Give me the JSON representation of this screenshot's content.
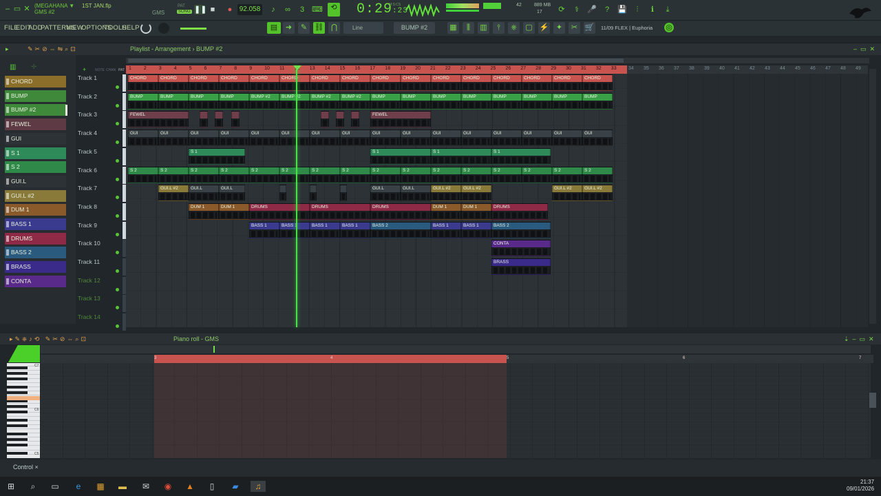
{
  "project": {
    "name": "(MEGAHANA ▼",
    "pattern": "GMS #2",
    "file": "1ST JAN.flp"
  },
  "transport": {
    "pat_label": "PAT",
    "song_label": "SONG",
    "tempo": "92.058",
    "time": "0:29",
    "time_small": ":23",
    "ms_label": "M:S:CS",
    "gms_label": "GMS"
  },
  "stats": {
    "mem": "889 MB",
    "cpu": "17",
    "poly": "42"
  },
  "menu": [
    "FILE",
    "EDIT",
    "ADD",
    "PATTERNS",
    "VIEW",
    "OPTIONS",
    "TOOLS",
    "HELP"
  ],
  "toolbar": {
    "snap": "Line",
    "pattern": "BUMP #2",
    "hint": "11/09  FLEX | Euphoria"
  },
  "playlist": {
    "title": "Playlist - Arrangement",
    "crumb": "BUMP #2",
    "snap_labels": [
      "NOTE",
      "CHAN",
      "PAT"
    ]
  },
  "browser": [
    {
      "name": "CHORD",
      "color": "#8a6e2a"
    },
    {
      "name": "BUMP",
      "color": "#3e8a3a"
    },
    {
      "name": "BUMP #2",
      "color": "#3e8a3a"
    },
    {
      "name": "FEWEL",
      "color": "#5e3a44"
    },
    {
      "name": "GUI",
      "color": "#2d3236"
    },
    {
      "name": "S 1",
      "color": "#2f8a5a"
    },
    {
      "name": "S 2",
      "color": "#2f8a4a"
    },
    {
      "name": "GUI.L",
      "color": "#2d3236"
    },
    {
      "name": "GUI.L #2",
      "color": "#8a7a3a"
    },
    {
      "name": "DUM 1",
      "color": "#8a5a2a"
    },
    {
      "name": "BASS 1",
      "color": "#3a3a8e"
    },
    {
      "name": "DRUMS",
      "color": "#8e2a46"
    },
    {
      "name": "BASS 2",
      "color": "#2a5a7e"
    },
    {
      "name": "BRASS",
      "color": "#3a2a8a"
    },
    {
      "name": "CONTA",
      "color": "#5a2a8a"
    }
  ],
  "tracks": [
    "Track 1",
    "Track 2",
    "Track 3",
    "Track 4",
    "Track 5",
    "Track 6",
    "Track 7",
    "Track 8",
    "Track 9",
    "Track 10",
    "Track 11",
    "Track 12",
    "Track 13",
    "Track 14"
  ],
  "ruler": [
    "1",
    "2",
    "3",
    "4",
    "5",
    "6",
    "7",
    "8",
    "9",
    "10",
    "11",
    "12",
    "13",
    "14",
    "15",
    "16",
    "17",
    "18",
    "19",
    "20",
    "21",
    "22",
    "23",
    "24",
    "25",
    "26",
    "27",
    "28",
    "29",
    "30",
    "31",
    "32",
    "33"
  ],
  "ruler2": [
    "34",
    "35",
    "36",
    "37",
    "38",
    "39",
    "40",
    "41",
    "42",
    "43",
    "44",
    "45",
    "46",
    "47",
    "48",
    "49"
  ],
  "clips": [
    {
      "row": 0,
      "l": 186,
      "w": 44,
      "label": "CHORD",
      "c": "#c85450"
    },
    {
      "row": 0,
      "l": 230,
      "w": 44,
      "label": "CHORD",
      "c": "#c85450"
    },
    {
      "row": 0,
      "l": 274,
      "w": 44,
      "label": "CHORD",
      "c": "#c85450"
    },
    {
      "row": 0,
      "l": 318,
      "w": 44,
      "label": "CHORD",
      "c": "#c85450"
    },
    {
      "row": 0,
      "l": 362,
      "w": 44,
      "label": "CHORD",
      "c": "#c85450"
    },
    {
      "row": 0,
      "l": 406,
      "w": 44,
      "label": "CHORD",
      "c": "#c85450"
    },
    {
      "row": 0,
      "l": 450,
      "w": 44,
      "label": "CHORD",
      "c": "#c85450"
    },
    {
      "row": 0,
      "l": 494,
      "w": 44,
      "label": "CHORD",
      "c": "#c85450"
    },
    {
      "row": 0,
      "l": 538,
      "w": 44,
      "label": "CHORD",
      "c": "#c85450"
    },
    {
      "row": 0,
      "l": 582,
      "w": 44,
      "label": "CHORD",
      "c": "#c85450"
    },
    {
      "row": 0,
      "l": 626,
      "w": 44,
      "label": "CHORD",
      "c": "#c85450"
    },
    {
      "row": 0,
      "l": 670,
      "w": 44,
      "label": "CHORD",
      "c": "#c85450"
    },
    {
      "row": 0,
      "l": 714,
      "w": 44,
      "label": "CHORD",
      "c": "#c85450"
    },
    {
      "row": 0,
      "l": 758,
      "w": 44,
      "label": "CHORD",
      "c": "#c85450"
    },
    {
      "row": 0,
      "l": 802,
      "w": 44,
      "label": "CHORD",
      "c": "#c85450"
    },
    {
      "row": 0,
      "l": 846,
      "w": 44,
      "label": "CHORD",
      "c": "#c85450"
    },
    {
      "row": 1,
      "l": 186,
      "w": 44,
      "label": "BUMP",
      "c": "#3aa048"
    },
    {
      "row": 1,
      "l": 230,
      "w": 44,
      "label": "BUMP",
      "c": "#3aa048"
    },
    {
      "row": 1,
      "l": 274,
      "w": 44,
      "label": "BUMP",
      "c": "#3aa048"
    },
    {
      "row": 1,
      "l": 318,
      "w": 44,
      "label": "BUMP",
      "c": "#3aa048"
    },
    {
      "row": 1,
      "l": 362,
      "w": 44,
      "label": "BUMP #2",
      "c": "#3aa048"
    },
    {
      "row": 1,
      "l": 406,
      "w": 44,
      "label": "BUMP #2",
      "c": "#3aa048"
    },
    {
      "row": 1,
      "l": 450,
      "w": 44,
      "label": "BUMP #2",
      "c": "#3aa048"
    },
    {
      "row": 1,
      "l": 494,
      "w": 44,
      "label": "BUMP #2",
      "c": "#3aa048"
    },
    {
      "row": 1,
      "l": 538,
      "w": 44,
      "label": "BUMP",
      "c": "#3aa048"
    },
    {
      "row": 1,
      "l": 582,
      "w": 44,
      "label": "BUMP",
      "c": "#3aa048"
    },
    {
      "row": 1,
      "l": 626,
      "w": 44,
      "label": "BUMP",
      "c": "#3aa048"
    },
    {
      "row": 1,
      "l": 670,
      "w": 44,
      "label": "BUMP",
      "c": "#3aa048"
    },
    {
      "row": 1,
      "l": 714,
      "w": 44,
      "label": "BUMP",
      "c": "#3aa048"
    },
    {
      "row": 1,
      "l": 758,
      "w": 44,
      "label": "BUMP",
      "c": "#3aa048"
    },
    {
      "row": 1,
      "l": 802,
      "w": 44,
      "label": "BUMP",
      "c": "#3aa048"
    },
    {
      "row": 1,
      "l": 846,
      "w": 44,
      "label": "BUMP",
      "c": "#3aa048"
    },
    {
      "row": 2,
      "l": 186,
      "w": 88,
      "label": "FEWEL",
      "c": "#6e3e4a"
    },
    {
      "row": 2,
      "l": 290,
      "w": 12,
      "label": "",
      "c": "#6e3e4a"
    },
    {
      "row": 2,
      "l": 312,
      "w": 12,
      "label": "",
      "c": "#6e3e4a"
    },
    {
      "row": 2,
      "l": 336,
      "w": 12,
      "label": "",
      "c": "#6e3e4a"
    },
    {
      "row": 2,
      "l": 466,
      "w": 12,
      "label": "",
      "c": "#6e3e4a"
    },
    {
      "row": 2,
      "l": 488,
      "w": 12,
      "label": "",
      "c": "#6e3e4a"
    },
    {
      "row": 2,
      "l": 510,
      "w": 12,
      "label": "",
      "c": "#6e3e4a"
    },
    {
      "row": 2,
      "l": 538,
      "w": 88,
      "label": "FEWEL",
      "c": "#6e3e4a"
    },
    {
      "row": 3,
      "l": 186,
      "w": 44,
      "label": "GUI",
      "c": "#3a4146"
    },
    {
      "row": 3,
      "l": 230,
      "w": 44,
      "label": "GUI",
      "c": "#3a4146"
    },
    {
      "row": 3,
      "l": 274,
      "w": 44,
      "label": "GUI",
      "c": "#3a4146"
    },
    {
      "row": 3,
      "l": 318,
      "w": 44,
      "label": "GUI",
      "c": "#3a4146"
    },
    {
      "row": 3,
      "l": 362,
      "w": 44,
      "label": "GUI",
      "c": "#3a4146"
    },
    {
      "row": 3,
      "l": 406,
      "w": 44,
      "label": "GUI",
      "c": "#3a4146"
    },
    {
      "row": 3,
      "l": 450,
      "w": 44,
      "label": "GUI",
      "c": "#3a4146"
    },
    {
      "row": 3,
      "l": 494,
      "w": 44,
      "label": "GUI",
      "c": "#3a4146"
    },
    {
      "row": 3,
      "l": 538,
      "w": 44,
      "label": "GUI",
      "c": "#3a4146"
    },
    {
      "row": 3,
      "l": 582,
      "w": 44,
      "label": "GUI",
      "c": "#3a4146"
    },
    {
      "row": 3,
      "l": 626,
      "w": 44,
      "label": "GUI",
      "c": "#3a4146"
    },
    {
      "row": 3,
      "l": 670,
      "w": 44,
      "label": "GUI",
      "c": "#3a4146"
    },
    {
      "row": 3,
      "l": 714,
      "w": 44,
      "label": "GUI",
      "c": "#3a4146"
    },
    {
      "row": 3,
      "l": 758,
      "w": 44,
      "label": "GUI",
      "c": "#3a4146"
    },
    {
      "row": 3,
      "l": 802,
      "w": 44,
      "label": "GUI",
      "c": "#3a4146"
    },
    {
      "row": 3,
      "l": 846,
      "w": 44,
      "label": "GUI",
      "c": "#3a4146"
    },
    {
      "row": 4,
      "l": 274,
      "w": 82,
      "label": "S 1",
      "c": "#2f8a5a"
    },
    {
      "row": 4,
      "l": 538,
      "w": 88,
      "label": "S 1",
      "c": "#2f8a5a"
    },
    {
      "row": 4,
      "l": 626,
      "w": 88,
      "label": "S 1",
      "c": "#2f8a5a"
    },
    {
      "row": 4,
      "l": 714,
      "w": 86,
      "label": "S 1",
      "c": "#2f8a5a"
    },
    {
      "row": 5,
      "l": 186,
      "w": 44,
      "label": "S 2",
      "c": "#2f8a4a"
    },
    {
      "row": 5,
      "l": 230,
      "w": 44,
      "label": "S 2",
      "c": "#2f8a4a"
    },
    {
      "row": 5,
      "l": 274,
      "w": 44,
      "label": "S 2",
      "c": "#2f8a4a"
    },
    {
      "row": 5,
      "l": 318,
      "w": 44,
      "label": "S 2",
      "c": "#2f8a4a"
    },
    {
      "row": 5,
      "l": 362,
      "w": 44,
      "label": "S 2",
      "c": "#2f8a4a"
    },
    {
      "row": 5,
      "l": 406,
      "w": 44,
      "label": "S 2",
      "c": "#2f8a4a"
    },
    {
      "row": 5,
      "l": 450,
      "w": 44,
      "label": "S 2",
      "c": "#2f8a4a"
    },
    {
      "row": 5,
      "l": 494,
      "w": 44,
      "label": "S 2",
      "c": "#2f8a4a"
    },
    {
      "row": 5,
      "l": 538,
      "w": 44,
      "label": "S 2",
      "c": "#2f8a4a"
    },
    {
      "row": 5,
      "l": 582,
      "w": 44,
      "label": "S 2",
      "c": "#2f8a4a"
    },
    {
      "row": 5,
      "l": 626,
      "w": 44,
      "label": "S 2",
      "c": "#2f8a4a"
    },
    {
      "row": 5,
      "l": 670,
      "w": 44,
      "label": "S 2",
      "c": "#2f8a4a"
    },
    {
      "row": 5,
      "l": 714,
      "w": 44,
      "label": "S 2",
      "c": "#2f8a4a"
    },
    {
      "row": 5,
      "l": 758,
      "w": 44,
      "label": "S 2",
      "c": "#2f8a4a"
    },
    {
      "row": 5,
      "l": 802,
      "w": 44,
      "label": "S 2",
      "c": "#2f8a4a"
    },
    {
      "row": 5,
      "l": 846,
      "w": 44,
      "label": "S 2",
      "c": "#2f8a4a"
    },
    {
      "row": 6,
      "l": 230,
      "w": 44,
      "label": "GUI.L #2",
      "c": "#8a7a3a"
    },
    {
      "row": 6,
      "l": 274,
      "w": 44,
      "label": "GUI.L",
      "c": "#3a4146"
    },
    {
      "row": 6,
      "l": 318,
      "w": 38,
      "label": "GUI.L",
      "c": "#3a4146"
    },
    {
      "row": 6,
      "l": 406,
      "w": 10,
      "label": "",
      "c": "#3a4146"
    },
    {
      "row": 6,
      "l": 450,
      "w": 10,
      "label": "",
      "c": "#3a4146"
    },
    {
      "row": 6,
      "l": 494,
      "w": 10,
      "label": "",
      "c": "#3a4146"
    },
    {
      "row": 6,
      "l": 538,
      "w": 44,
      "label": "GUI.L",
      "c": "#3a4146"
    },
    {
      "row": 6,
      "l": 582,
      "w": 44,
      "label": "GUI.L",
      "c": "#3a4146"
    },
    {
      "row": 6,
      "l": 626,
      "w": 44,
      "label": "GUI.L #2",
      "c": "#8a7a3a"
    },
    {
      "row": 6,
      "l": 670,
      "w": 44,
      "label": "GUI.L #2",
      "c": "#8a7a3a"
    },
    {
      "row": 6,
      "l": 802,
      "w": 44,
      "label": "GUI.L #2",
      "c": "#8a7a3a"
    },
    {
      "row": 6,
      "l": 846,
      "w": 44,
      "label": "GUI.L #2",
      "c": "#8a7a3a"
    },
    {
      "row": 7,
      "l": 274,
      "w": 44,
      "label": "DUM 1",
      "c": "#8a5a2a"
    },
    {
      "row": 7,
      "l": 318,
      "w": 44,
      "label": "DUM 1",
      "c": "#8a5a2a"
    },
    {
      "row": 7,
      "l": 362,
      "w": 88,
      "label": "DRUMS",
      "c": "#8e2a46"
    },
    {
      "row": 7,
      "l": 450,
      "w": 88,
      "label": "DRUMS",
      "c": "#8e2a46"
    },
    {
      "row": 7,
      "l": 538,
      "w": 88,
      "label": "DRUMS",
      "c": "#8e2a46"
    },
    {
      "row": 7,
      "l": 626,
      "w": 44,
      "label": "DUM 1",
      "c": "#8a5a2a"
    },
    {
      "row": 7,
      "l": 670,
      "w": 44,
      "label": "DUM 1",
      "c": "#8a5a2a"
    },
    {
      "row": 7,
      "l": 714,
      "w": 82,
      "label": "DRUMS",
      "c": "#8e2a46"
    },
    {
      "row": 8,
      "l": 362,
      "w": 44,
      "label": "BASS 1",
      "c": "#3a3a8e"
    },
    {
      "row": 8,
      "l": 406,
      "w": 44,
      "label": "BASS 1",
      "c": "#3a3a8e"
    },
    {
      "row": 8,
      "l": 450,
      "w": 44,
      "label": "BASS 1",
      "c": "#3a3a8e"
    },
    {
      "row": 8,
      "l": 494,
      "w": 44,
      "label": "BASS 1",
      "c": "#3a3a8e"
    },
    {
      "row": 8,
      "l": 538,
      "w": 88,
      "label": "BASS 2",
      "c": "#2a5a7e"
    },
    {
      "row": 8,
      "l": 626,
      "w": 44,
      "label": "BASS 1",
      "c": "#3a3a8e"
    },
    {
      "row": 8,
      "l": 670,
      "w": 44,
      "label": "BASS 1",
      "c": "#3a3a8e"
    },
    {
      "row": 8,
      "l": 714,
      "w": 86,
      "label": "BASS 2",
      "c": "#2a5a7e"
    },
    {
      "row": 9,
      "l": 714,
      "w": 86,
      "label": "CONTA",
      "c": "#5a2a8a"
    },
    {
      "row": 10,
      "l": 714,
      "w": 86,
      "label": "BRASS",
      "c": "#3a2a8a"
    }
  ],
  "pianoroll": {
    "title": "Piano roll - GMS",
    "ruler": [
      "3",
      "4",
      "5",
      "6",
      "7"
    ],
    "keys": [
      "C7",
      "C6",
      "C5"
    ]
  },
  "bottom": {
    "control": "Control",
    "close": "×"
  },
  "clock": {
    "time": "21:37",
    "date": "09/01/2026"
  },
  "colors": {
    "accent": "#5fd03a",
    "ruler": "#c85450"
  }
}
